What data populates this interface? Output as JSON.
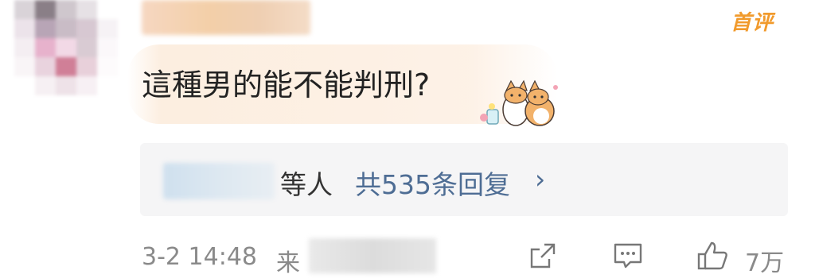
{
  "comment": {
    "badge": "首评",
    "text": "這種男的能不能判刑?"
  },
  "replies": {
    "suffix": "等人",
    "count_label": "共535条回复",
    "chevron": "›"
  },
  "meta": {
    "time": "3-2 14:48",
    "from_label": "来",
    "like_count": "7万"
  },
  "icons": {
    "share": "share-icon",
    "comment": "comment-icon",
    "like": "thumbs-up-icon",
    "sticker": "corgi-sticker"
  },
  "colors": {
    "badge": "#f19a2c",
    "link": "#4e6d94",
    "meta": "#8a8a8a"
  }
}
